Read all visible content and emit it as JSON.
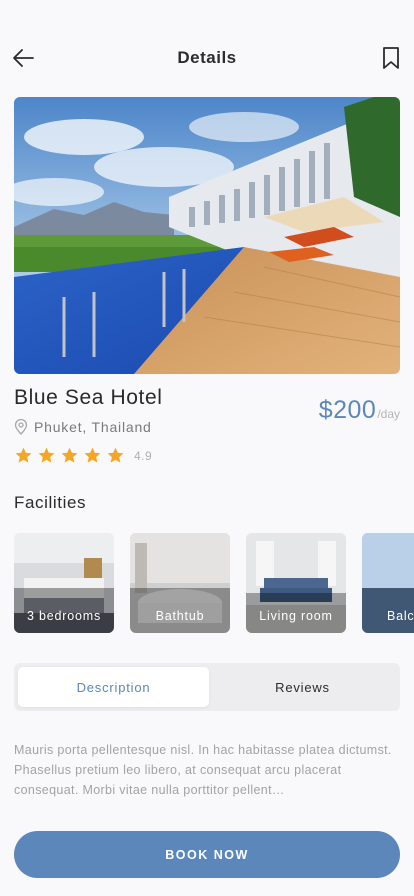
{
  "header": {
    "title": "Details",
    "back_icon": "arrow-left-icon",
    "bookmark_icon": "bookmark-icon"
  },
  "hotel": {
    "name": "Blue Sea Hotel",
    "location": "Phuket, Thailand",
    "location_icon": "map-pin-icon",
    "price": "$200",
    "price_unit": "/day",
    "rating": 4.9,
    "rating_text": "4.9",
    "stars": 5,
    "star_color": "#f5a623"
  },
  "facilities": {
    "title": "Facilities",
    "items": [
      {
        "label": "3 bedrooms"
      },
      {
        "label": "Bathtub"
      },
      {
        "label": "Living room"
      },
      {
        "label": "Balcony"
      }
    ]
  },
  "tabs": [
    {
      "label": "Description",
      "active": true
    },
    {
      "label": "Reviews",
      "active": false
    }
  ],
  "description": "Mauris porta pellentesque nisl. In hac habitasse platea dictumst. Phasellus pretium leo libero, at consequat arcu placerat consequat. Morbi vitae nulla porttitor pellent…",
  "book_button": "BOOK NOW",
  "colors": {
    "accent": "#5b87ba",
    "background": "#f9f9fb"
  }
}
